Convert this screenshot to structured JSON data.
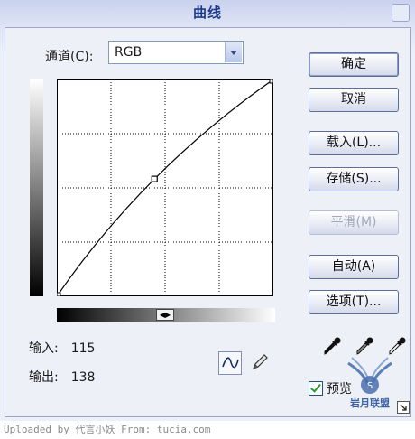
{
  "window": {
    "title": "曲线"
  },
  "channel": {
    "label": "通道(C):",
    "value": "RGB"
  },
  "readout": {
    "input_label": "输入:",
    "input_value": "115",
    "output_label": "输出:",
    "output_value": "138"
  },
  "buttons": {
    "ok": "确定",
    "cancel": "取消",
    "load": "载入(L)...",
    "save": "存储(S)...",
    "smooth": "平滑(M)",
    "auto": "自动(A)",
    "options": "选项(T)..."
  },
  "preview": {
    "label": "预览",
    "checked": true
  },
  "watermark": {
    "text": "Uploaded by 代言小妖  From: tucia.com"
  },
  "logo": {
    "text": "岩月联盟"
  },
  "curve": {
    "points": [
      [
        0,
        0
      ],
      [
        115,
        138
      ],
      [
        255,
        255
      ]
    ],
    "grid_divisions": 4
  },
  "colors": {
    "title": "#1d3a8a",
    "button_border": "#5d6e9c",
    "checkmark": "#21a121"
  },
  "icons": [
    "close-icon",
    "curve-tool-icon",
    "pencil-tool-icon",
    "black-eyedropper-icon",
    "gray-eyedropper-icon",
    "white-eyedropper-icon",
    "resize-grip-icon"
  ]
}
